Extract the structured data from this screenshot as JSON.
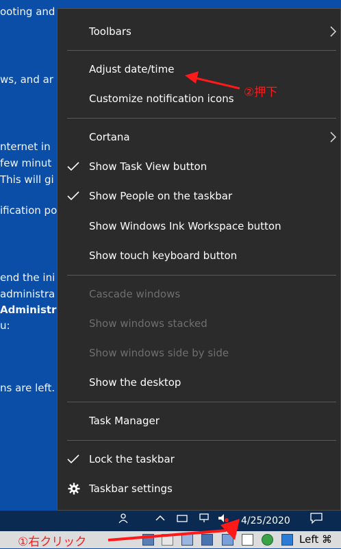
{
  "background_lines": [
    "ooting and",
    "ws, and ar",
    "nternet in",
    " few minut",
    "This will gi",
    "ification po",
    "end the ini",
    " administra",
    "Administra",
    "u:",
    "ns are left."
  ],
  "menu": {
    "items": [
      {
        "label": "Toolbars",
        "submenu": true
      },
      {
        "label": "Adjust date/time"
      },
      {
        "label": "Customize notification icons"
      },
      {
        "label": "Cortana",
        "submenu": true
      },
      {
        "label": "Show Task View button",
        "checked": true
      },
      {
        "label": "Show People on the taskbar",
        "checked": true
      },
      {
        "label": "Show Windows Ink Workspace button"
      },
      {
        "label": "Show touch keyboard button"
      },
      {
        "label": "Cascade windows",
        "disabled": true
      },
      {
        "label": "Show windows stacked",
        "disabled": true
      },
      {
        "label": "Show windows side by side",
        "disabled": true
      },
      {
        "label": "Show the desktop"
      },
      {
        "label": "Task Manager"
      },
      {
        "label": "Lock the taskbar",
        "checked": true
      },
      {
        "label": "Taskbar settings",
        "icon": "gear-icon"
      }
    ]
  },
  "taskbar": {
    "date": "4/25/2020"
  },
  "annotations": {
    "step1": "①右クリック",
    "step2": "②押下",
    "color": "#ff1a1a"
  },
  "host_bar": {
    "keyboard_label": "Left ⌘"
  },
  "colors": {
    "menu_bg": "#2b2b2b",
    "desktop_bg": "#0a4ea8",
    "disabled_text": "#6f6f6f"
  }
}
